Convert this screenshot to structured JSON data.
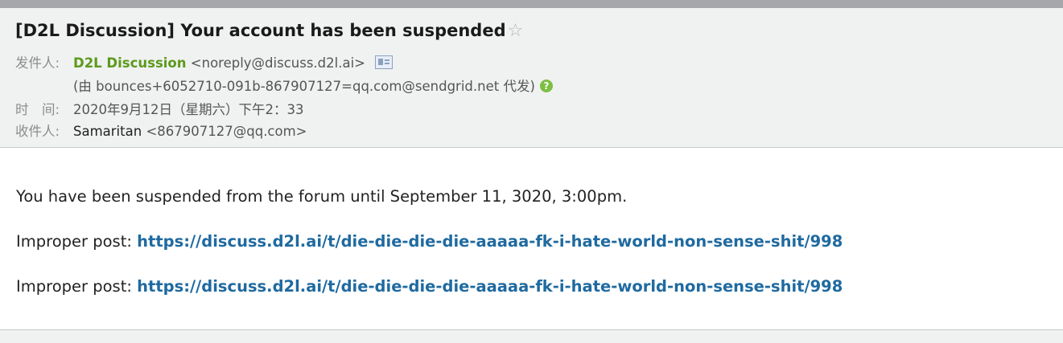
{
  "email": {
    "subject": "[D2L Discussion] Your account has been suspended",
    "from_label": "发件人:",
    "from_name": "D2L Discussion",
    "from_address": "<noreply@discuss.d2l.ai>",
    "on_behalf": "(由 bounces+6052710-091b-867907127=qq.com@sendgrid.net 代发)",
    "time_label": "时　间:",
    "time_value": "2020年9月12日（星期六）下午2：33",
    "to_label": "收件人:",
    "to_name": "Samaritan",
    "to_address": "<867907127@qq.com>"
  },
  "body": {
    "line1": "You have been suspended from the forum until September 11, 3020, 3:00pm.",
    "improper_label": "Improper post:",
    "link1": "https://discuss.d2l.ai/t/die-die-die-die-aaaaa-fk-i-hate-world-non-sense-shit/998",
    "link2": "https://discuss.d2l.ai/t/die-die-die-die-aaaaa-fk-i-hate-world-non-sense-shit/998"
  },
  "icons": {
    "star": "star-icon",
    "contact_card": "contact-card-icon",
    "help": "help-icon"
  },
  "colors": {
    "sender": "#5c9a1b",
    "link": "#1f6aa0",
    "header_bg": "#f0f1f1"
  }
}
